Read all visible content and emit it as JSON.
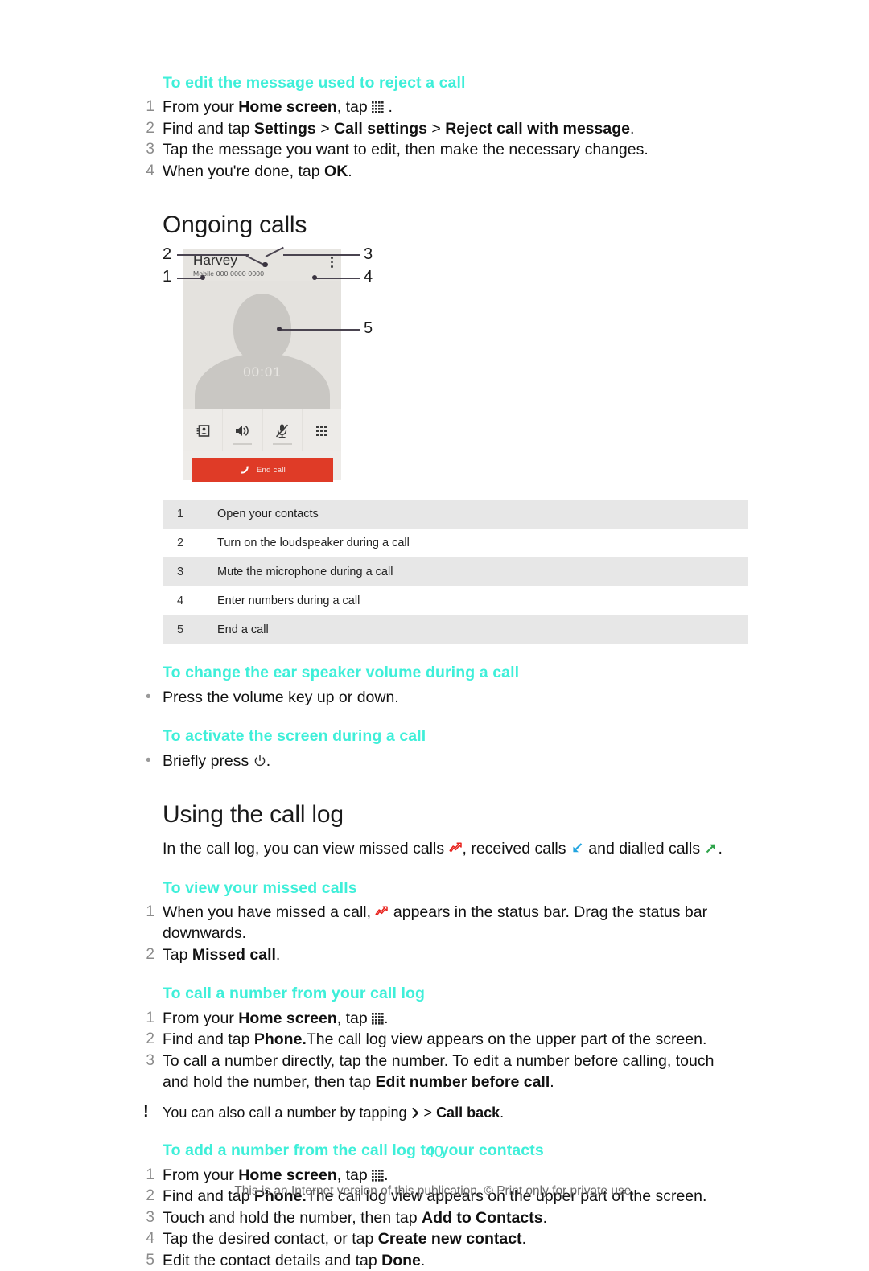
{
  "page": {
    "number": "40",
    "footnote": "This is an Internet version of this publication. © Print only for private use."
  },
  "colors": {
    "heading_teal": "#3fefd9",
    "end_call_red": "#df3b27",
    "missed_call_red": "#e8211c",
    "received_call_blue": "#22a5e0",
    "dialled_call_green": "#2da34a",
    "table_row_shade": "#e7e7e7"
  },
  "sections": {
    "reject_message": {
      "heading": "To edit the message used to reject a call",
      "steps": [
        {
          "num": "1",
          "parts": [
            {
              "t": "From your ",
              "b": false
            },
            {
              "t": "Home screen",
              "b": true
            },
            {
              "t": ", tap ",
              "b": false
            },
            {
              "icon": "apps-grid-icon"
            },
            {
              "t": " .",
              "b": false
            }
          ]
        },
        {
          "num": "2",
          "parts": [
            {
              "t": "Find and tap ",
              "b": false
            },
            {
              "t": "Settings",
              "b": true
            },
            {
              "t": " > ",
              "b": false
            },
            {
              "t": "Call settings",
              "b": true
            },
            {
              "t": " > ",
              "b": false
            },
            {
              "t": "Reject call with message",
              "b": true
            },
            {
              "t": ".",
              "b": false
            }
          ]
        },
        {
          "num": "3",
          "parts": [
            {
              "t": "Tap the message you want to edit, then make the necessary changes.",
              "b": false
            }
          ]
        },
        {
          "num": "4",
          "parts": [
            {
              "t": "When you're done, tap ",
              "b": false
            },
            {
              "t": "OK",
              "b": true
            },
            {
              "t": ".",
              "b": false
            }
          ]
        }
      ]
    },
    "ongoing_calls": {
      "heading": "Ongoing calls",
      "mock": {
        "contact_name": "Harvey",
        "contact_number": "Mobile 000 0000 0000",
        "call_timer": "00:01",
        "end_call_label": "End call",
        "overflow_icon": "kebab-menu-icon",
        "controls": [
          {
            "icon": "contacts-icon",
            "callout": "1"
          },
          {
            "icon": "loudspeaker-icon",
            "callout": "2"
          },
          {
            "icon": "mute-microphone-icon",
            "callout": "3"
          },
          {
            "icon": "dialpad-icon",
            "callout": "4"
          }
        ],
        "end_call_callout": "5"
      },
      "legend": [
        {
          "idx": "1",
          "text": "Open your contacts"
        },
        {
          "idx": "2",
          "text": "Turn on the loudspeaker during a call"
        },
        {
          "idx": "3",
          "text": "Mute the microphone during a call"
        },
        {
          "idx": "4",
          "text": "Enter numbers during a call"
        },
        {
          "idx": "5",
          "text": "End a call"
        }
      ]
    },
    "ear_speaker_volume": {
      "heading": "To change the ear speaker volume during a call",
      "bullets": [
        {
          "parts": [
            {
              "t": "Press the volume key up or down.",
              "b": false
            }
          ]
        }
      ]
    },
    "activate_screen": {
      "heading": "To activate the screen during a call",
      "bullets": [
        {
          "parts": [
            {
              "t": "Briefly press ",
              "b": false
            },
            {
              "icon": "power-icon"
            },
            {
              "t": ".",
              "b": false
            }
          ]
        }
      ]
    },
    "call_log": {
      "heading": "Using the call log",
      "intro_parts": [
        {
          "t": "In the call log, you can view missed calls ",
          "b": false
        },
        {
          "icon": "missed-call-icon"
        },
        {
          "t": ", received calls ",
          "b": false
        },
        {
          "icon": "received-call-icon"
        },
        {
          "t": " and dialled calls ",
          "b": false
        },
        {
          "icon": "dialled-call-icon"
        },
        {
          "t": ".",
          "b": false
        }
      ]
    },
    "view_missed_calls": {
      "heading": "To view your missed calls",
      "steps": [
        {
          "num": "1",
          "parts": [
            {
              "t": "When you have missed a call, ",
              "b": false
            },
            {
              "icon": "missed-call-icon"
            },
            {
              "t": " appears in the status bar. Drag the status bar downwards.",
              "b": false
            }
          ]
        },
        {
          "num": "2",
          "parts": [
            {
              "t": "Tap ",
              "b": false
            },
            {
              "t": "Missed call",
              "b": true
            },
            {
              "t": ".",
              "b": false
            }
          ]
        }
      ]
    },
    "call_from_log": {
      "heading": "To call a number from your call log",
      "steps": [
        {
          "num": "1",
          "parts": [
            {
              "t": "From your ",
              "b": false
            },
            {
              "t": "Home screen",
              "b": true
            },
            {
              "t": ", tap ",
              "b": false
            },
            {
              "icon": "apps-grid-icon"
            },
            {
              "t": ".",
              "b": false
            }
          ]
        },
        {
          "num": "2",
          "parts": [
            {
              "t": "Find and tap ",
              "b": false
            },
            {
              "t": "Phone.",
              "b": true
            },
            {
              "t": "The call log view appears on the upper part of the screen.",
              "b": false
            }
          ]
        },
        {
          "num": "3",
          "parts": [
            {
              "t": "To call a number directly, tap the number. To edit a number before calling, touch and hold the number, then tap ",
              "b": false
            },
            {
              "t": "Edit number before call",
              "b": true
            },
            {
              "t": ".",
              "b": false
            }
          ]
        }
      ],
      "tip_parts": [
        {
          "t": "You can also call a number by tapping ",
          "b": false
        },
        {
          "icon": "chevron-right-icon"
        },
        {
          "t": " > ",
          "b": false
        },
        {
          "t": "Call back",
          "b": true
        },
        {
          "t": ".",
          "b": false
        }
      ]
    },
    "add_from_log": {
      "heading": "To add a number from the call log to your contacts",
      "steps": [
        {
          "num": "1",
          "parts": [
            {
              "t": "From your ",
              "b": false
            },
            {
              "t": "Home screen",
              "b": true
            },
            {
              "t": ", tap ",
              "b": false
            },
            {
              "icon": "apps-grid-icon"
            },
            {
              "t": ".",
              "b": false
            }
          ]
        },
        {
          "num": "2",
          "parts": [
            {
              "t": "Find and tap ",
              "b": false
            },
            {
              "t": "Phone.",
              "b": true
            },
            {
              "t": "The call log view appears on the upper part of the screen.",
              "b": false
            }
          ]
        },
        {
          "num": "3",
          "parts": [
            {
              "t": "Touch and hold the number, then tap ",
              "b": false
            },
            {
              "t": "Add to Contacts",
              "b": true
            },
            {
              "t": ".",
              "b": false
            }
          ]
        },
        {
          "num": "4",
          "parts": [
            {
              "t": "Tap the desired contact, or tap ",
              "b": false
            },
            {
              "t": "Create new contact",
              "b": true
            },
            {
              "t": ".",
              "b": false
            }
          ]
        },
        {
          "num": "5",
          "parts": [
            {
              "t": "Edit the contact details and tap ",
              "b": false
            },
            {
              "t": "Done",
              "b": true
            },
            {
              "t": ".",
              "b": false
            }
          ]
        }
      ]
    }
  }
}
